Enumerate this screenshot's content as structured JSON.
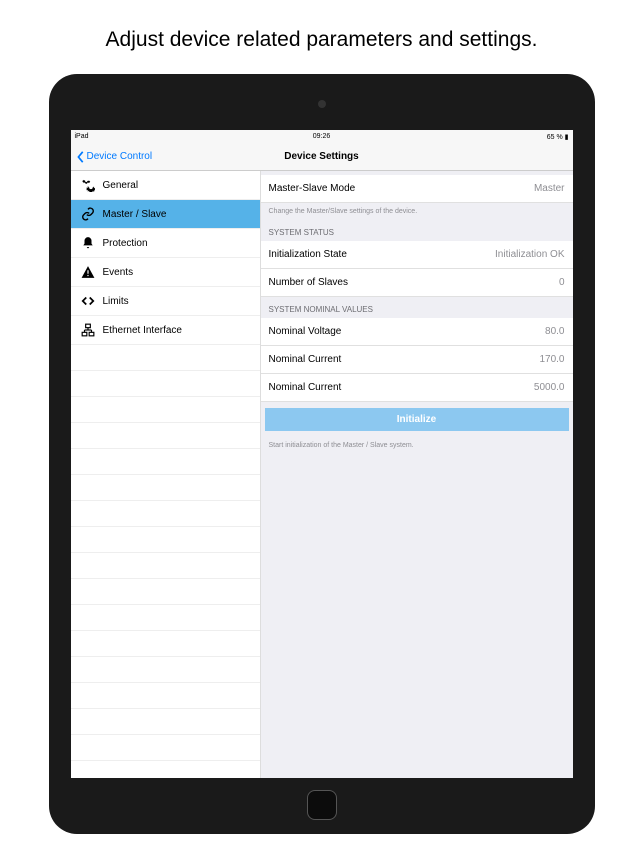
{
  "promo": "Adjust device related parameters and settings.",
  "statusbar": {
    "carrier": "iPad",
    "time": "09:26",
    "battery": "65 %"
  },
  "navbar": {
    "back": "Device Control",
    "title": "Device Settings"
  },
  "sidebar": {
    "items": [
      {
        "label": "General"
      },
      {
        "label": "Master / Slave"
      },
      {
        "label": "Protection"
      },
      {
        "label": "Events"
      },
      {
        "label": "Limits"
      },
      {
        "label": "Ethernet Interface"
      }
    ]
  },
  "detail": {
    "mode_row": {
      "label": "Master-Slave Mode",
      "value": "Master"
    },
    "mode_note": "Change the Master/Slave settings of the device.",
    "status_header": "SYSTEM STATUS",
    "status_rows": [
      {
        "label": "Initialization State",
        "value": "Initialization OK"
      },
      {
        "label": "Number of Slaves",
        "value": "0"
      }
    ],
    "nominal_header": "SYSTEM NOMINAL VALUES",
    "nominal_rows": [
      {
        "label": "Nominal Voltage",
        "value": "80.0"
      },
      {
        "label": "Nominal Current",
        "value": "170.0"
      },
      {
        "label": "Nominal Current",
        "value": "5000.0"
      }
    ],
    "init_button": "Initialize",
    "init_note": "Start initialization of the Master / Slave system."
  }
}
